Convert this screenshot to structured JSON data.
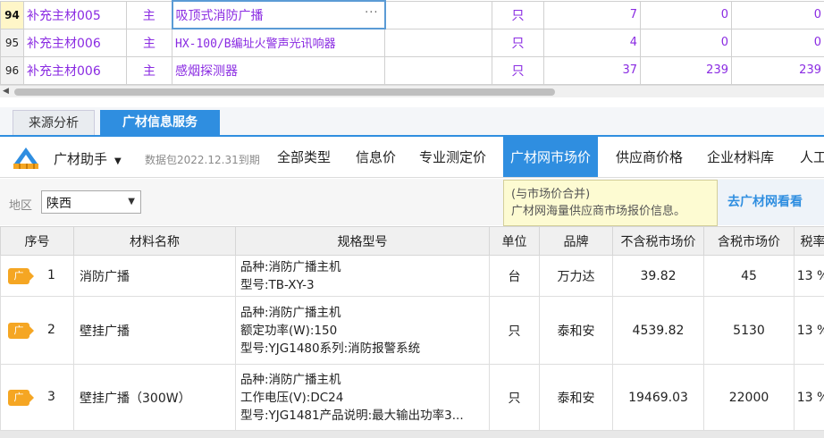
{
  "top_rows": [
    {
      "num": "94",
      "selected": true,
      "code": "补充主材005",
      "type": "主",
      "name": "吸顶式消防广播",
      "unit": "只",
      "qty": "7",
      "v1": "0",
      "v2": "0"
    },
    {
      "num": "95",
      "selected": false,
      "code": "补充主材006",
      "type": "主",
      "name": "HX-100/B编址火警声光讯响器",
      "unit": "只",
      "qty": "4",
      "v1": "0",
      "v2": "0"
    },
    {
      "num": "96",
      "selected": false,
      "code": "补充主材006",
      "type": "主",
      "name": "感烟探测器",
      "unit": "只",
      "qty": "37",
      "v1": "239",
      "v2": "239"
    }
  ],
  "edit_dots": "···",
  "tabs": {
    "source": "来源分析",
    "info": "广材信息服务"
  },
  "toolbar": {
    "helper": "广材助手",
    "caret": "▼",
    "package": "数据包2022.12.31到期",
    "menu": [
      "全部类型",
      "信息价",
      "专业测定价",
      "广材网市场价",
      "供应商价格",
      "企业材料库",
      "人工"
    ]
  },
  "filter": {
    "label": "地区",
    "region": "陕西",
    "arrow": "▼"
  },
  "tooltip": {
    "line1": "(与市场价合并)",
    "line2": "广材网海量供应商市场报价信息。"
  },
  "go_button": "去广材网看看",
  "table": {
    "headers": [
      "序号",
      "材料名称",
      "规格型号",
      "单位",
      "品牌",
      "不含税市场价",
      "含税市场价",
      "税率"
    ],
    "badge": "广",
    "rows": [
      {
        "seq": "1",
        "name": "消防广播",
        "spec": [
          "品种:消防广播主机",
          "型号:TB-XY-3"
        ],
        "unit": "台",
        "brand": "万力达",
        "price_ex": "39.82",
        "price_in": "45",
        "tax": "13 %"
      },
      {
        "seq": "2",
        "name": "壁挂广播",
        "spec": [
          "品种:消防广播主机",
          "额定功率(W):150",
          "型号:YJG1480系列:消防报警系统"
        ],
        "unit": "只",
        "brand": "泰和安",
        "price_ex": "4539.82",
        "price_in": "5130",
        "tax": "13 %"
      },
      {
        "seq": "3",
        "name": "壁挂广播（300W）",
        "spec": [
          "品种:消防广播主机",
          "工作电压(V):DC24",
          "型号:YJG1481产品说明:最大输出功率3..."
        ],
        "unit": "只",
        "brand": "泰和安",
        "price_ex": "19469.03",
        "price_in": "22000",
        "tax": "13 %"
      }
    ]
  },
  "colors": {
    "accent": "#2f8ee0",
    "purple_text": "#8a2be2",
    "badge": "#f5a623",
    "tooltip_bg": "#fdfbd2"
  }
}
